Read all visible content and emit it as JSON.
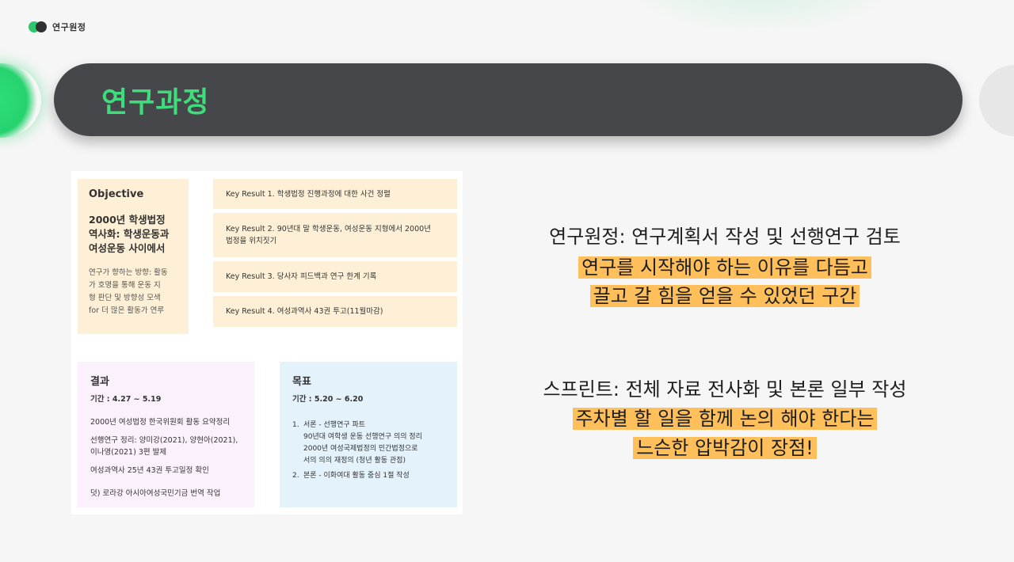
{
  "brand": {
    "label": "연구원정"
  },
  "banner": {
    "title": "연구과정"
  },
  "okr": {
    "objective": {
      "heading": "Objective",
      "title_lines": [
        "2000년 학생법정",
        "역사화: 학생운동과",
        "여성운동 사이에서"
      ],
      "description_lines": [
        "연구가 향하는 방향: 활동",
        "가 호명을 통해 운동 지",
        "형 판단 및 방향성 모색",
        "for 더 많은 활동가 연루"
      ]
    },
    "key_results": [
      {
        "lines": [
          "Key Result 1. 학생법정 진행과정에 대한 사건 정렬"
        ]
      },
      {
        "lines": [
          "Key Result 2. 90년대 말 학생운동, 여성운동 지형에서 2000년",
          "법정을 위치짓기"
        ]
      },
      {
        "lines": [
          "Key Result 3. 당사자 피드백과 연구 한계 기록"
        ]
      },
      {
        "lines": [
          "Key Result 4. 여성과역사 43권 투고(11월마감)"
        ]
      }
    ],
    "results": {
      "heading": "결과",
      "period": "기간 :   4.27 ~ 5.19",
      "items": [
        "2000년 여성법정 한국위원회 활동 요약정리",
        "선행연구 정리: 양미강(2021), 양현아(2021),",
        "이나영(2021) 3편 발제",
        "여성과역사 25년 43권 투고일정 확인",
        "덧) 로라강 아시아여성국민기금 번역 작업"
      ]
    },
    "goals": {
      "heading": "목표",
      "period": "기간 :   5.20 ~  6.20",
      "items": [
        {
          "num": "1.",
          "lines": [
            "서론 - 선행연구 파트",
            "90년대 여학생 운동 선행연구 의의 정리",
            "2000년 여성국제법정의 민간법정으로",
            "서의 의의 재정의 (청년 활동 관점)"
          ]
        },
        {
          "num": "2.",
          "lines": [
            "본론 - 이화여대 활동 중심 1절 작성"
          ]
        }
      ]
    }
  },
  "summary": {
    "line1": "연구원정: 연구계획서 작성 및 선행연구 검토",
    "line2": "연구를 시작해야 하는 이유를 다듬고",
    "line3": "끌고 갈 힘을 얻을 수 있었던 구간",
    "line4": "스프린트: 전체 자료 전사화 및 본론 일부 작성",
    "line5": "주차별 할 일을 함께 논의 해야 한다는",
    "line6": "느슨한 압박감이 장점!"
  },
  "colors": {
    "accent_green": "#3fdc7c",
    "banner_bg": "#46474b",
    "highlight": "#ffbf5a",
    "okr_yellow": "#fdf0d6",
    "result_pink": "#fbf1fc",
    "goal_blue": "#e3f2fb"
  }
}
